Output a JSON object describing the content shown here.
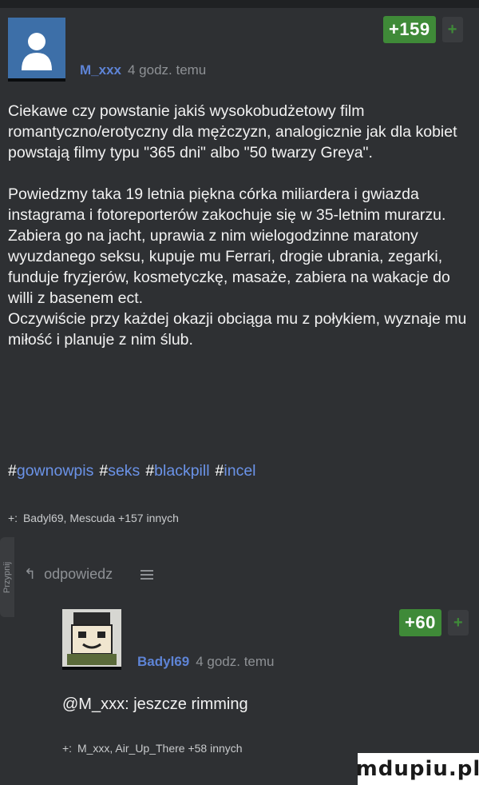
{
  "post": {
    "author": "M_xxx",
    "time": "4 godz. temu",
    "score": "+159",
    "vote_plus": "+",
    "paragraphs": [
      "Ciekawe czy powstanie jakiś wysokobudżetowy film romantyczno/erotyczny dla mężczyzn, analogicznie jak dla kobiet powstają filmy typu \"365 dni\" albo \"50 twarzy Greya\".",
      "Powiedzmy taka 19 letnia piękna córka miliardera i gwiazda instagrama i fotoreporterów zakochuje się w 35-letnim murarzu. Zabiera go na jacht, uprawia z nim wielogodzinne maratony wyuzdanego seksu, kupuje mu Ferrari, drogie ubrania, zegarki, funduje fryzjerów, kosmetyczkę, masaże, zabiera na wakacje do willi z basenem ect.",
      "Oczywiście przy każdej okazji obciąga mu z połykiem, wyznaje mu miłość i planuje z nim ślub."
    ],
    "tags": [
      "gownowpis",
      "seks",
      "blackpill",
      "incel"
    ],
    "plus_label": "+:",
    "plus_users": "Badyl69, Mescuda +157 innych"
  },
  "actions": {
    "reply_label": "odpowiedz"
  },
  "side_tab": {
    "label": "Przypnij"
  },
  "reply": {
    "author": "Badyl69",
    "time": "4 godz. temu",
    "score": "+60",
    "vote_plus": "+",
    "mention": "@M_xxx:",
    "text": "jeszcze rimming",
    "plus_label": "+:",
    "plus_users": "M_xxx, Air_Up_There +58 innych"
  },
  "watermark": {
    "text": "mdupiu.pl"
  },
  "colors": {
    "background": "#2e3033",
    "score_green": "#3f8a38",
    "author_blue": "#5e84d6",
    "tag_blue": "#6b93e8"
  }
}
